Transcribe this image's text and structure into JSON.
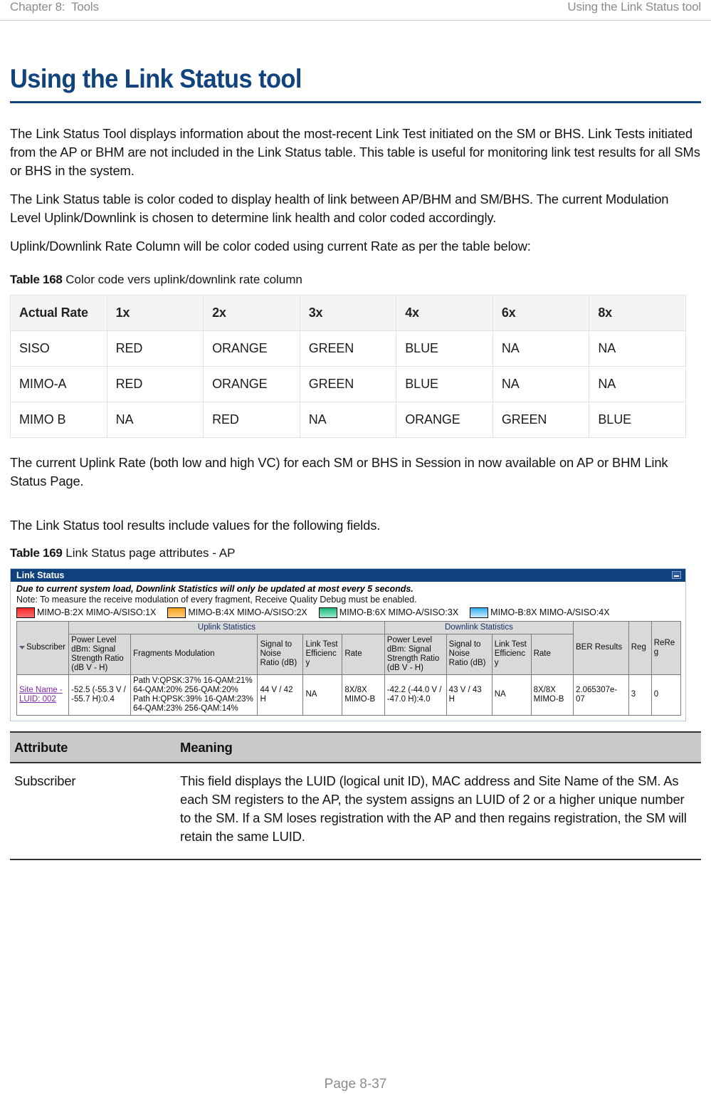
{
  "header": {
    "left": "Chapter 8:  Tools",
    "right": "Using the Link Status tool"
  },
  "title": "Using the Link Status tool",
  "paragraphs": {
    "p1": "The Link Status Tool displays information about the most-recent Link Test initiated on the SM or BHS. Link Tests initiated from the AP or BHM are not included in the Link Status table. This table is useful for monitoring link test results for all SMs or BHS in the system.",
    "p2": "The Link Status table is color coded to display health of link between AP/BHM and SM/BHS. The current Modulation Level Uplink/Downlink is chosen to determine link health and color coded accordingly.",
    "p3": "Uplink/Downlink Rate Column will be color coded using current Rate as per the table below:",
    "p4": "The current Uplink Rate (both low and high VC) for each SM or BHS in Session in now available on AP or BHM Link Status Page.",
    "p5": "The Link Status tool results include values for the following fields."
  },
  "table168": {
    "label": "Table 168",
    "caption": "Color code vers uplink/downlink rate column",
    "columns": [
      "Actual Rate",
      "1x",
      "2x",
      "3x",
      "4x",
      "6x",
      "8x"
    ],
    "rows": [
      {
        "name": "SISO",
        "cells": [
          {
            "text": "RED",
            "color": "red"
          },
          {
            "text": "ORANGE",
            "color": "orange"
          },
          {
            "text": "GREEN",
            "color": "green"
          },
          {
            "text": "BLUE",
            "color": "blue"
          },
          {
            "text": "NA",
            "color": "na"
          },
          {
            "text": "NA",
            "color": "na"
          }
        ]
      },
      {
        "name": "MIMO-A",
        "cells": [
          {
            "text": "RED",
            "color": "red"
          },
          {
            "text": "ORANGE",
            "color": "orange"
          },
          {
            "text": "GREEN",
            "color": "green"
          },
          {
            "text": "BLUE",
            "color": "blue"
          },
          {
            "text": "NA",
            "color": "na"
          },
          {
            "text": "NA",
            "color": "na"
          }
        ]
      },
      {
        "name": "MIMO B",
        "cells": [
          {
            "text": "NA",
            "color": "na"
          },
          {
            "text": "RED",
            "color": "red"
          },
          {
            "text": "NA",
            "color": "na"
          },
          {
            "text": "ORANGE",
            "color": "orange"
          },
          {
            "text": "GREEN",
            "color": "green"
          },
          {
            "text": "BLUE",
            "color": "blue"
          }
        ]
      }
    ],
    "colors": {
      "red": "#ff0000",
      "orange": "#f96a0b",
      "green": "#1d8a4e",
      "blue": "#a9d5f3",
      "na": "#1c1c1c"
    }
  },
  "table169": {
    "label": "Table 169",
    "caption": "Link Status page attributes - AP"
  },
  "screenshot": {
    "window_title": "Link Status",
    "warning": "Due to current system load, Downlink Statistics will only be updated at most every 5 seconds.",
    "note": "Note: To measure the receive modulation of every fragment, Receive Quality Debug must be enabled.",
    "legend": [
      {
        "swatch": "red",
        "label": "MIMO-B:2X MIMO-A/SISO:1X"
      },
      {
        "swatch": "orange",
        "label": "MIMO-B:4X MIMO-A/SISO:2X"
      },
      {
        "swatch": "green",
        "label": "MIMO-B:6X MIMO-A/SISO:3X"
      },
      {
        "swatch": "blue",
        "label": "MIMO-B:8X MIMO-A/SISO:4X"
      }
    ],
    "group_headers": {
      "uplink": "Uplink Statistics",
      "downlink": "Downlink Statistics"
    },
    "columns": {
      "subscriber": "Subscriber",
      "ul_power": "Power Level dBm: Signal Strength Ratio (dB V - H)",
      "ul_frag": "Fragments Modulation",
      "ul_snr": "Signal to Noise Ratio (dB)",
      "ul_lte": "Link Test Efficiency",
      "ul_rate": "Rate",
      "dl_power": "Power Level dBm: Signal Strength Ratio (dB V - H)",
      "dl_snr": "Signal to Noise Ratio (dB)",
      "dl_lte": "Link Test Efficiency",
      "dl_rate": "Rate",
      "ber": "BER Results",
      "reg": "Reg",
      "rereg": "ReReg"
    },
    "row": {
      "subscriber": "Site Name - LUID: 002",
      "ul_power": "-52.5 (-55.3 V / -55.7 H):0.4",
      "ul_frag": "Path V:QPSK:37% 16-QAM:21% 64-QAM:20% 256-QAM:20% Path H:QPSK:39% 16-QAM:23% 64-QAM:23% 256-QAM:14%",
      "ul_snr": "44 V / 42 H",
      "ul_lte": "NA",
      "ul_rate": "8X/8X MIMO-B",
      "dl_power": "-42.2 (-44.0 V / -47.0 H):4.0",
      "dl_snr": "43 V / 43 H",
      "dl_lte": "NA",
      "dl_rate": "8X/8X MIMO-B",
      "ber": "2.065307e-07",
      "reg": "3",
      "rereg": "0"
    }
  },
  "attributes_table": {
    "columns": [
      "Attribute",
      "Meaning"
    ],
    "rows": [
      {
        "attribute": "Subscriber",
        "meaning": "This field displays the LUID (logical unit ID), MAC address and Site Name of the SM. As each SM registers to the AP, the system assigns an LUID of 2 or a higher unique number to the SM. If a SM loses registration with the AP and then regains registration, the SM will retain the same LUID."
      }
    ]
  },
  "footer": {
    "page": "Page 8-37"
  }
}
